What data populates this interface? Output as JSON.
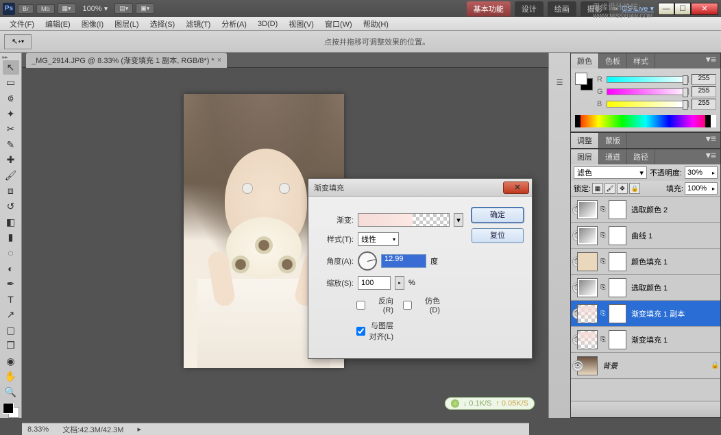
{
  "titlebar": {
    "br": "Br",
    "mb": "Mb",
    "zoom": "100% ▾",
    "workspaces": [
      "基本功能",
      "设计",
      "绘画",
      "摄影"
    ],
    "cslive": "CS Live ▾",
    "watermark": "思缘设计论坛",
    "watermark2": "WWW.MISSYUAN.COM"
  },
  "menu": [
    "文件(F)",
    "编辑(E)",
    "图像(I)",
    "图层(L)",
    "选择(S)",
    "滤镜(T)",
    "分析(A)",
    "3D(D)",
    "视图(V)",
    "窗口(W)",
    "帮助(H)"
  ],
  "options_hint": "点按并拖移可调整效果的位置。",
  "doc_tab": "_MG_2914.JPG @ 8.33% (渐变填充 1 副本, RGB/8*) *",
  "color_panel": {
    "tabs": [
      "颜色",
      "色板",
      "样式"
    ],
    "r": "255",
    "g": "255",
    "b": "255"
  },
  "adjust_tabs": [
    "调整",
    "蒙版"
  ],
  "layers_panel": {
    "tabs": [
      "图层",
      "通道",
      "路径"
    ],
    "blend": "滤色",
    "opacity_label": "不透明度:",
    "opacity": "30%",
    "lock_label": "锁定:",
    "fill_label": "填充:",
    "fill": "100%",
    "layers": [
      {
        "name": "选取颜色 2",
        "type": "adj-sel"
      },
      {
        "name": "曲线 1",
        "type": "adj-curve"
      },
      {
        "name": "颜色填充 1",
        "type": "fill",
        "fill": "#ead8bc"
      },
      {
        "name": "选取颜色 1",
        "type": "adj-sel"
      },
      {
        "name": "渐变填充 1 副本",
        "type": "grad",
        "selected": true
      },
      {
        "name": "渐变填充 1",
        "type": "grad"
      },
      {
        "name": "背景",
        "type": "bg",
        "italic": true,
        "locked": true
      }
    ]
  },
  "dialog": {
    "title": "渐变填充",
    "ok": "确定",
    "reset": "复位",
    "grad_label": "渐变:",
    "style_label": "样式(T):",
    "style_val": "线性",
    "angle_label": "角度(A):",
    "angle_val": "12.99",
    "angle_unit": "度",
    "scale_label": "缩放(S):",
    "scale_val": "100",
    "scale_unit": "%",
    "reverse": "反向(R)",
    "dither": "仿色(D)",
    "align": "与图层对齐(L)"
  },
  "status": {
    "down": "↓ 0.1K/S",
    "up": "↑ 0.05K/S",
    "zoom": "8.33%",
    "docsize": "文档:42.3M/42.3M"
  }
}
